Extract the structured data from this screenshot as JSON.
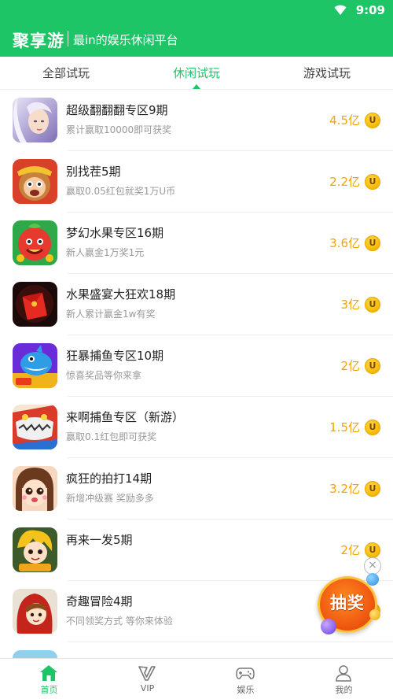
{
  "status_bar": {
    "time": "9:09"
  },
  "header": {
    "title": "聚享游",
    "slogan": "最in的娱乐休闲平台"
  },
  "tabs": [
    {
      "label": "全部试玩",
      "active": false
    },
    {
      "label": "休闲试玩",
      "active": true
    },
    {
      "label": "游戏试玩",
      "active": false
    }
  ],
  "games": [
    {
      "title": "超级翻翻翻专区9期",
      "subtitle": "累计赢取10000即可获奖",
      "prize": "4.5亿",
      "icon": "fairy-avatar-icon"
    },
    {
      "title": "别找茬5期",
      "subtitle": "赢取0.05红包就奖1万U币",
      "prize": "2.2亿",
      "icon": "monkey-king-icon"
    },
    {
      "title": "梦幻水果专区16期",
      "subtitle": "新人赢金1万奖1元",
      "prize": "3.6亿",
      "icon": "fruit-icon"
    },
    {
      "title": "水果盛宴大狂欢18期",
      "subtitle": "新人累计赢金1w有奖",
      "prize": "3亿",
      "icon": "red-envelope-icon"
    },
    {
      "title": "狂暴捕鱼专区10期",
      "subtitle": "惊喜奖品等你来拿",
      "prize": "2亿",
      "icon": "shark-icon"
    },
    {
      "title": "来啊捕鱼专区（新游）",
      "subtitle": "赢取0.1红包即可获奖",
      "prize": "1.5亿",
      "icon": "fish-monster-icon"
    },
    {
      "title": "疯狂的拍打14期",
      "subtitle": "新增冲级赛 奖励多多",
      "prize": "3.2亿",
      "icon": "cartoon-girl-icon"
    },
    {
      "title": "再来一发5期",
      "subtitle": "",
      "prize": "2亿",
      "icon": "anime-hero-icon"
    },
    {
      "title": "奇趣冒险4期",
      "subtitle": "不同领奖方式 等你来体验",
      "prize": "",
      "icon": "red-hood-icon"
    },
    {
      "title": "",
      "subtitle": "",
      "prize": "",
      "icon": "partial-game-icon"
    }
  ],
  "coin_symbol": "U",
  "lottery": {
    "label": "抽奖",
    "close": "×"
  },
  "bottom_nav": [
    {
      "label": "首页",
      "icon": "home-icon",
      "active": true
    },
    {
      "label": "VIP",
      "icon": "vip-icon",
      "active": false
    },
    {
      "label": "娱乐",
      "icon": "gamepad-icon",
      "active": false
    },
    {
      "label": "我的",
      "icon": "user-icon",
      "active": false
    }
  ],
  "colors": {
    "brand_green": "#1ec567",
    "prize_orange": "#f2a300",
    "text_dark": "#222222",
    "text_gray": "#999999"
  }
}
